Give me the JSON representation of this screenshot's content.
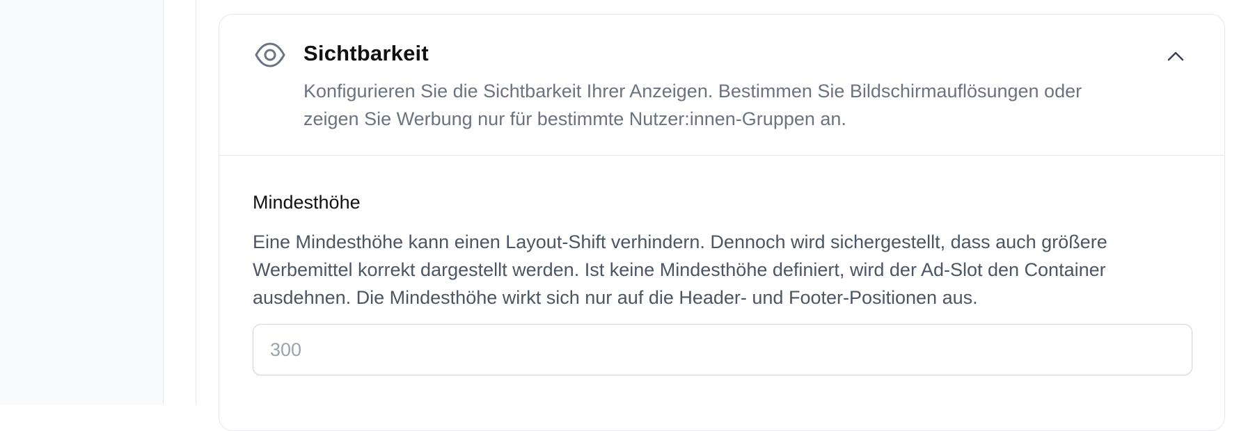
{
  "visibility_section": {
    "icon": "eye-icon",
    "title": "Sichtbarkeit",
    "description": "Konfigurieren Sie die Sichtbarkeit Ihrer Anzeigen. Bestimmen Sie Bildschirmauflösungen oder zeigen Sie Werbung nur für bestimmte Nutzer:innen-Gruppen an.",
    "collapse_icon": "chevron-up-icon",
    "expanded": true
  },
  "min_height_field": {
    "label": "Mindesthöhe",
    "help": "Eine Mindesthöhe kann einen Layout-Shift verhindern. Dennoch wird sichergestellt, dass auch größere Werbemittel korrekt dargestellt werden. Ist keine Mindesthöhe definiert, wird der Ad-Slot den Container ausdehnen. Die Mindesthöhe wirkt sich nur auf die Header- und Footer-Positionen aus.",
    "value": "",
    "placeholder": "300"
  },
  "colors": {
    "sidebar_bg": "#f9fafb",
    "border": "#e5e7eb",
    "muted_text": "#6b7280",
    "icon": "#6b7280"
  }
}
